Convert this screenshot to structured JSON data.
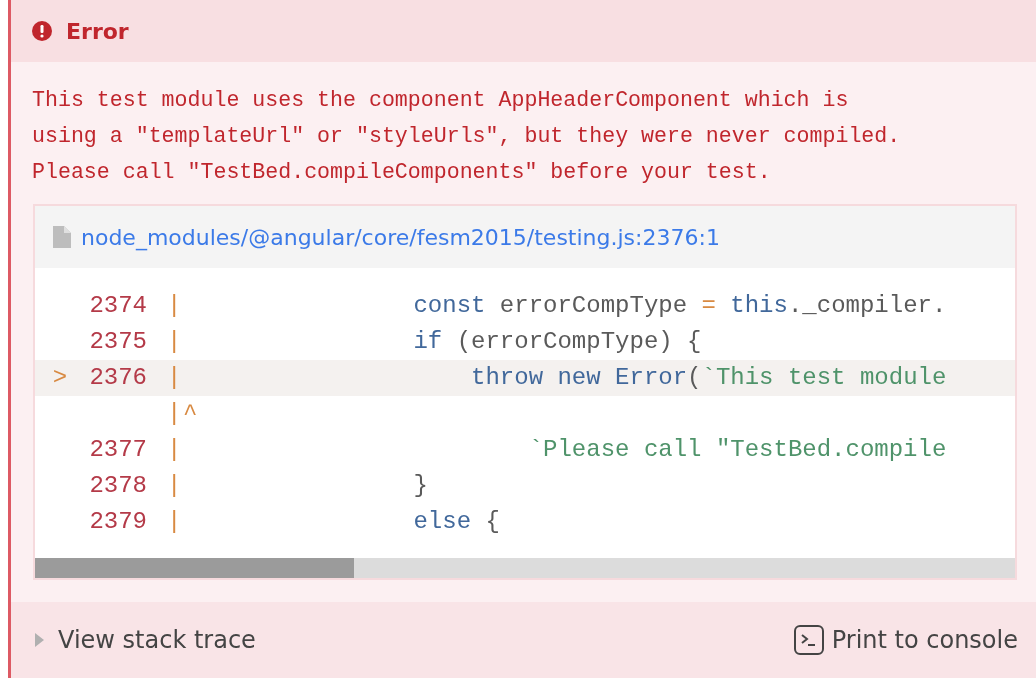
{
  "header": {
    "title": "Error"
  },
  "message": "This test module uses the component AppHeaderComponent which is\nusing a \"templateUrl\" or \"styleUrls\", but they were never compiled.\nPlease call \"TestBed.compileComponents\" before your test.",
  "code_frame": {
    "file": "node_modules/@angular/core/fesm2015/testing.js:2376:1",
    "lines": [
      {
        "kind": "code",
        "number": "2374",
        "gutter": "|",
        "selected": false,
        "tokens": [
          {
            "kind": "keyword",
            "text": "                const"
          },
          {
            "kind": "plain",
            "text": " errorCompType "
          },
          {
            "kind": "op",
            "text": "="
          },
          {
            "kind": "keyword",
            "text": " this"
          },
          {
            "kind": "plain",
            "text": "._compiler."
          }
        ]
      },
      {
        "kind": "code",
        "number": "2375",
        "gutter": "|",
        "selected": false,
        "tokens": [
          {
            "kind": "keyword",
            "text": "                if"
          },
          {
            "kind": "plain",
            "text": " (errorCompType) {"
          }
        ]
      },
      {
        "kind": "code",
        "marker": ">",
        "number": "2376",
        "gutter": "|",
        "selected": true,
        "tokens": [
          {
            "kind": "keyword",
            "text": "                    throw new Error"
          },
          {
            "kind": "plain",
            "text": "("
          },
          {
            "kind": "string",
            "text": "`This test module"
          }
        ]
      },
      {
        "kind": "pointer",
        "gutter": "|",
        "caret": "^"
      },
      {
        "kind": "code",
        "number": "2377",
        "gutter": "|",
        "selected": false,
        "tokens": [
          {
            "kind": "string",
            "text": "                        `Please call \"TestBed.compile"
          }
        ]
      },
      {
        "kind": "code",
        "number": "2378",
        "gutter": "|",
        "selected": false,
        "tokens": [
          {
            "kind": "plain",
            "text": "                }"
          }
        ]
      },
      {
        "kind": "code",
        "number": "2379",
        "gutter": "|",
        "selected": false,
        "tokens": [
          {
            "kind": "keyword",
            "text": "                else"
          },
          {
            "kind": "plain",
            "text": " {"
          }
        ]
      }
    ]
  },
  "footer": {
    "stack_toggle": "View stack trace",
    "expanded": false,
    "print_button": "Print to console"
  }
}
